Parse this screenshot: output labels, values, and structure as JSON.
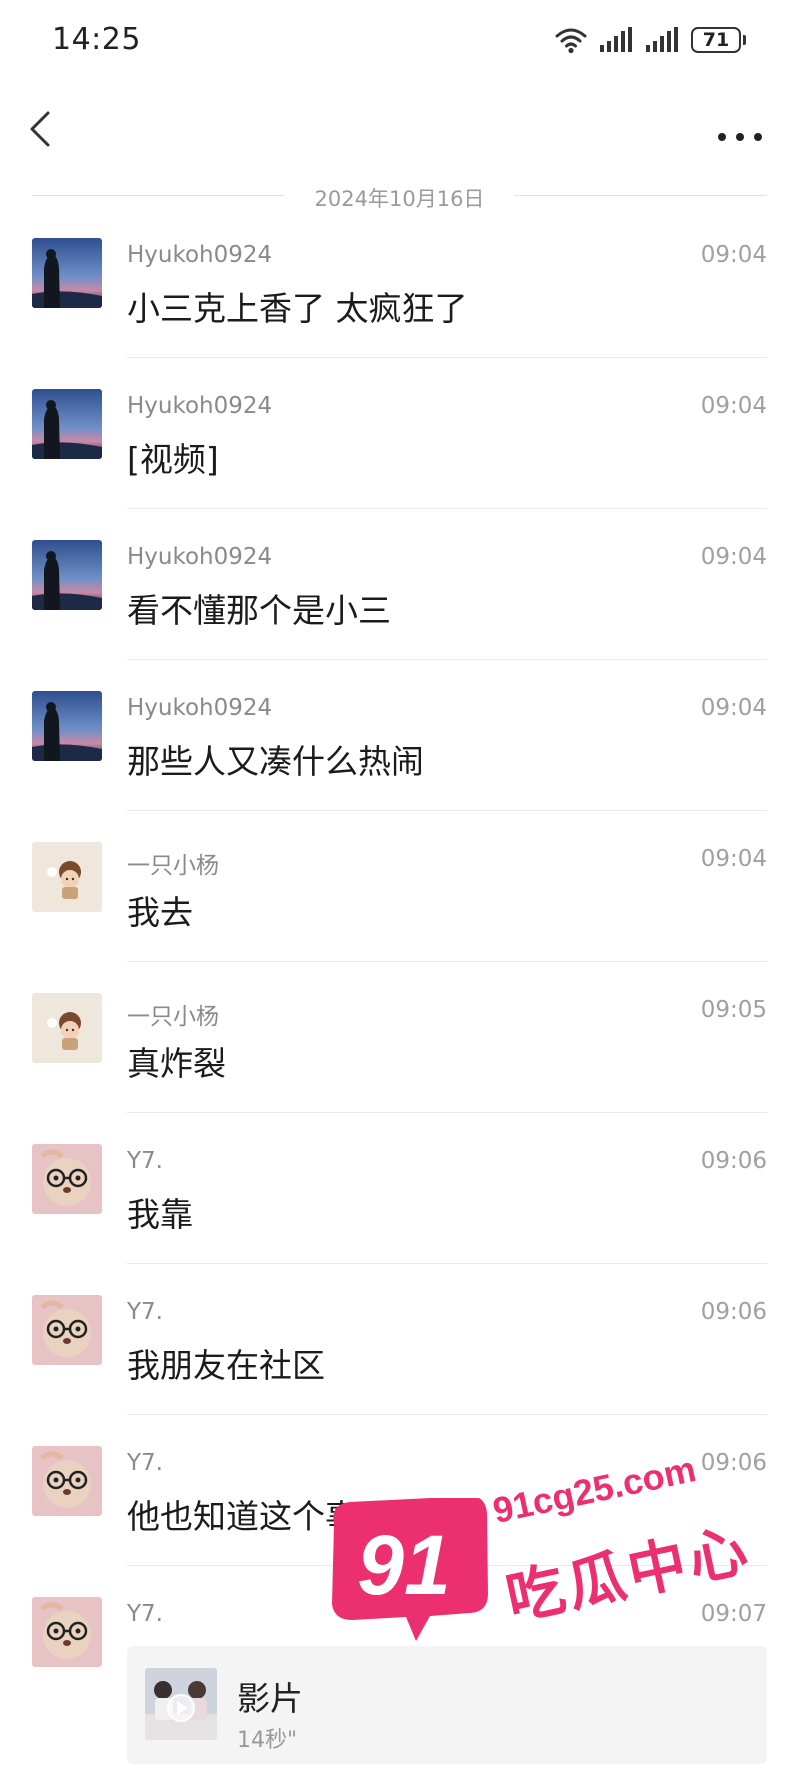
{
  "status_bar": {
    "time": "14:25",
    "battery": "71"
  },
  "date_divider": "2024年10月16日",
  "messages": [
    {
      "sender": "Hyukoh0924",
      "time": "09:04",
      "text": "小三克上香了 太疯狂了",
      "avatar": "hyukoh"
    },
    {
      "sender": "Hyukoh0924",
      "time": "09:04",
      "text": "[视频]",
      "avatar": "hyukoh"
    },
    {
      "sender": "Hyukoh0924",
      "time": "09:04",
      "text": "看不懂那个是小三",
      "avatar": "hyukoh"
    },
    {
      "sender": "Hyukoh0924",
      "time": "09:04",
      "text": "那些人又凑什么热闹",
      "avatar": "hyukoh"
    },
    {
      "sender": "一只小杨",
      "time": "09:04",
      "text": "我去",
      "avatar": "yang"
    },
    {
      "sender": "一只小杨",
      "time": "09:05",
      "text": "真炸裂",
      "avatar": "yang"
    },
    {
      "sender": "Y7.",
      "time": "09:06",
      "text": "我靠",
      "avatar": "y7"
    },
    {
      "sender": "Y7.",
      "time": "09:06",
      "text": "我朋友在社区",
      "avatar": "y7"
    },
    {
      "sender": "Y7.",
      "time": "09:06",
      "text": "他也知道这个事",
      "avatar": "y7"
    },
    {
      "sender": "Y7.",
      "time": "09:07",
      "video": {
        "title": "影片",
        "duration": "14秒\""
      },
      "avatar": "y7"
    }
  ],
  "watermark": {
    "badge": "91",
    "url": "91cg25.com",
    "slogan": "吃瓜中心"
  },
  "colors": {
    "watermark": "#ec2f6f",
    "divider": "#e9e9e9",
    "meta_text": "#a0a0a0"
  },
  "icons": {
    "back": "chevron-left-icon",
    "more": "more-dots-icon",
    "wifi": "wifi-icon",
    "signal": "signal-icon",
    "battery": "battery-icon",
    "play": "play-icon"
  }
}
